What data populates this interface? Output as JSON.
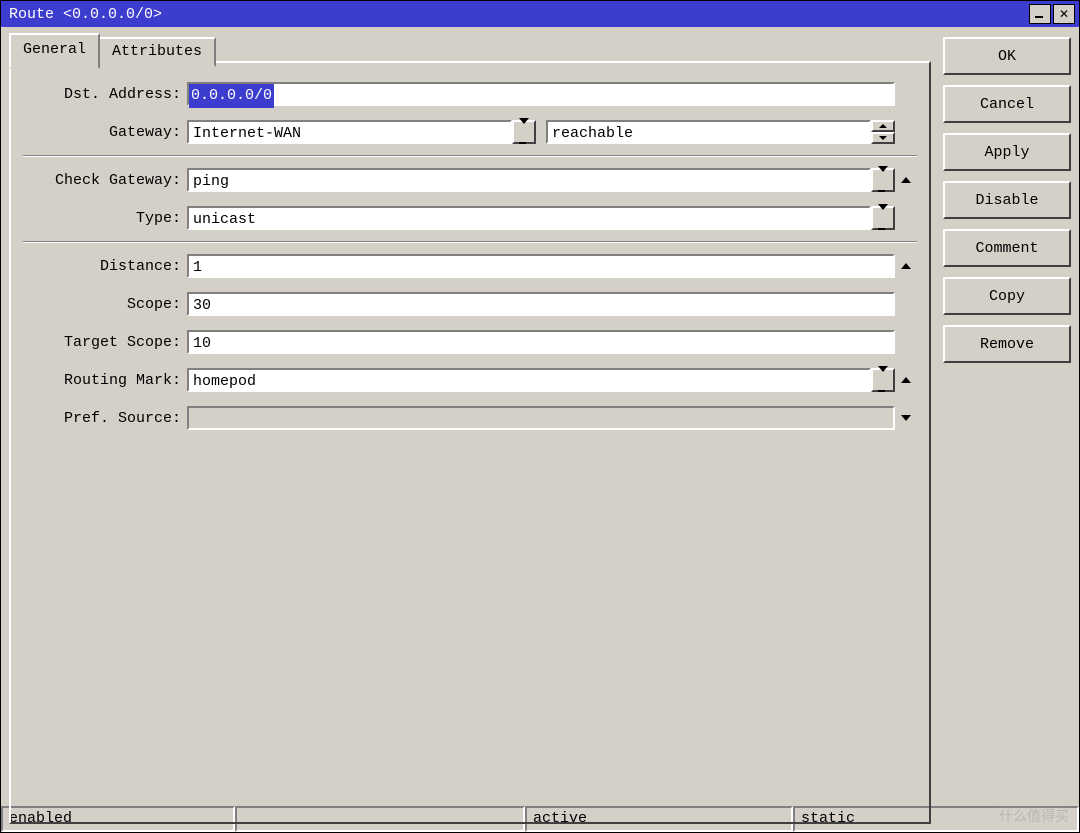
{
  "window": {
    "title": "Route <0.0.0.0/0>"
  },
  "tabs": {
    "general": "General",
    "attributes": "Attributes"
  },
  "labels": {
    "dst_address": "Dst. Address:",
    "gateway": "Gateway:",
    "check_gateway": "Check Gateway:",
    "type": "Type:",
    "distance": "Distance:",
    "scope": "Scope:",
    "target_scope": "Target Scope:",
    "routing_mark": "Routing Mark:",
    "pref_source": "Pref. Source:"
  },
  "values": {
    "dst_address": "0.0.0.0/0",
    "gateway": "Internet-WAN",
    "gateway_status": "reachable",
    "check_gateway": "ping",
    "type": "unicast",
    "distance": "1",
    "scope": "30",
    "target_scope": "10",
    "routing_mark": "homepod",
    "pref_source": ""
  },
  "buttons": {
    "ok": "OK",
    "cancel": "Cancel",
    "apply": "Apply",
    "disable": "Disable",
    "comment": "Comment",
    "copy": "Copy",
    "remove": "Remove"
  },
  "status": {
    "enabled": "enabled",
    "active": "active",
    "static": "static"
  },
  "watermark": "什么值得买"
}
